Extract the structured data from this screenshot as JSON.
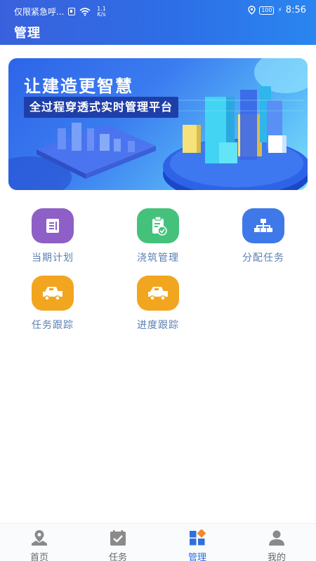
{
  "status_bar": {
    "carrier": "仅限紧急呼...",
    "net_speed": "1.1\nK/s",
    "battery": "100",
    "time": "8:56"
  },
  "header": {
    "title": "管理"
  },
  "banner": {
    "title": "让建造更智慧",
    "subtitle": "全过程穿透式实时管理平台"
  },
  "menu": [
    {
      "label": "当期计划",
      "icon": "document-icon",
      "color": "#8e5fc7"
    },
    {
      "label": "浇筑管理",
      "icon": "clipboard-check-icon",
      "color": "#44c27c"
    },
    {
      "label": "分配任务",
      "icon": "org-chart-icon",
      "color": "#3f78e8"
    },
    {
      "label": "任务跟踪",
      "icon": "truck-icon",
      "color": "#f2a51f"
    },
    {
      "label": "进度跟踪",
      "icon": "truck-icon",
      "color": "#f2a51f"
    }
  ],
  "tabbar": {
    "items": [
      {
        "label": "首页",
        "icon": "map-pin-icon"
      },
      {
        "label": "任务",
        "icon": "calendar-check-icon"
      },
      {
        "label": "管理",
        "icon": "grid-icon"
      },
      {
        "label": "我的",
        "icon": "user-icon"
      }
    ],
    "active": "管理",
    "active_color": "#2f6fdf"
  }
}
